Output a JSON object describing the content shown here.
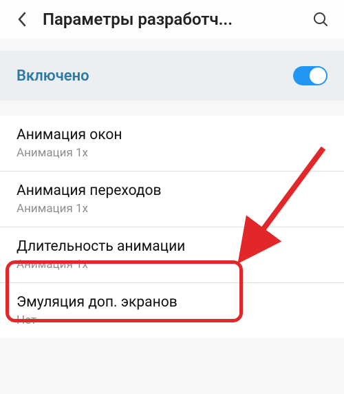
{
  "header": {
    "title": "Параметры разработч..."
  },
  "toggle": {
    "label": "Включено",
    "state": "on"
  },
  "items": [
    {
      "title": "Анимация окон",
      "sub": "Анимация 1x"
    },
    {
      "title": "Анимация переходов",
      "sub": "Анимация 1x"
    },
    {
      "title": "Длительность анимации",
      "sub": "Анимация 1x"
    },
    {
      "title": "Эмуляция доп. экранов",
      "sub": "Нет"
    }
  ],
  "annotation": {
    "highlight_color": "#e2272a"
  }
}
